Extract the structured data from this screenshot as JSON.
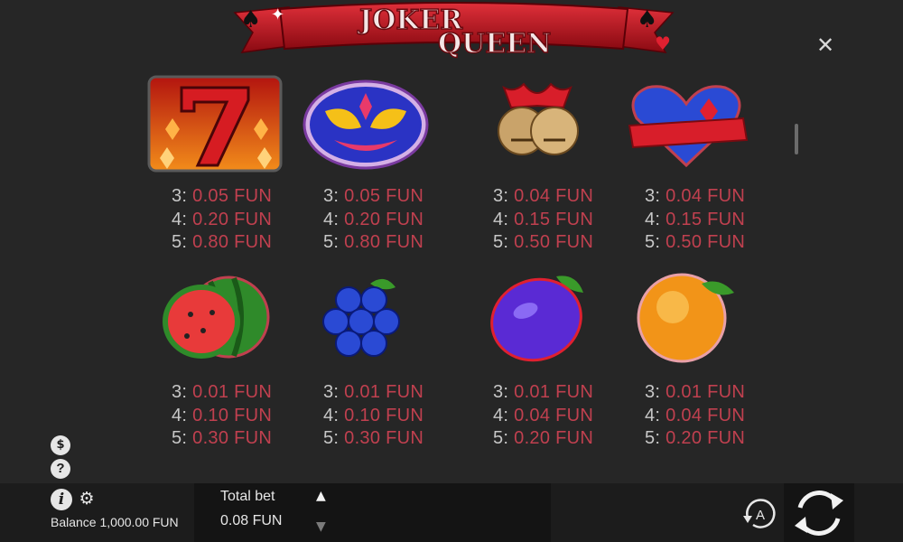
{
  "game": {
    "logo_line1": "JOKER",
    "logo_line2": "QUEEN"
  },
  "close": {
    "label": "✕"
  },
  "paytable": [
    {
      "symbol": "seven-icon",
      "pays": [
        {
          "count": "3:",
          "amount": "0.05 FUN"
        },
        {
          "count": "4:",
          "amount": "0.20 FUN"
        },
        {
          "count": "5:",
          "amount": "0.80 FUN"
        }
      ]
    },
    {
      "symbol": "mask-icon",
      "pays": [
        {
          "count": "3:",
          "amount": "0.05 FUN"
        },
        {
          "count": "4:",
          "amount": "0.20 FUN"
        },
        {
          "count": "5:",
          "amount": "0.80 FUN"
        }
      ]
    },
    {
      "symbol": "bells-icon",
      "pays": [
        {
          "count": "3:",
          "amount": "0.04 FUN"
        },
        {
          "count": "4:",
          "amount": "0.15 FUN"
        },
        {
          "count": "5:",
          "amount": "0.50 FUN"
        }
      ]
    },
    {
      "symbol": "heart-icon",
      "pays": [
        {
          "count": "3:",
          "amount": "0.04 FUN"
        },
        {
          "count": "4:",
          "amount": "0.15 FUN"
        },
        {
          "count": "5:",
          "amount": "0.50 FUN"
        }
      ]
    },
    {
      "symbol": "watermelon-icon",
      "pays": [
        {
          "count": "3:",
          "amount": "0.01 FUN"
        },
        {
          "count": "4:",
          "amount": "0.10 FUN"
        },
        {
          "count": "5:",
          "amount": "0.30 FUN"
        }
      ]
    },
    {
      "symbol": "grapes-icon",
      "pays": [
        {
          "count": "3:",
          "amount": "0.01 FUN"
        },
        {
          "count": "4:",
          "amount": "0.10 FUN"
        },
        {
          "count": "5:",
          "amount": "0.30 FUN"
        }
      ]
    },
    {
      "symbol": "plum-icon",
      "pays": [
        {
          "count": "3:",
          "amount": "0.01 FUN"
        },
        {
          "count": "4:",
          "amount": "0.04 FUN"
        },
        {
          "count": "5:",
          "amount": "0.20 FUN"
        }
      ]
    },
    {
      "symbol": "orange-icon",
      "pays": [
        {
          "count": "3:",
          "amount": "0.01 FUN"
        },
        {
          "count": "4:",
          "amount": "0.04 FUN"
        },
        {
          "count": "5:",
          "amount": "0.20 FUN"
        }
      ]
    }
  ],
  "footer": {
    "balance": "Balance 1,000.00 FUN",
    "total_bet_label": "Total bet",
    "total_bet_value": "0.08 FUN",
    "bet_up_icon": "▲",
    "bet_down_icon": "▼",
    "autoplay_letter": "A",
    "coins_icon": "$",
    "help_icon": "?",
    "info_icon": "i",
    "settings_icon": "⚙"
  },
  "colors": {
    "background": "#262626",
    "payout_amount": "#c0404f",
    "payout_count": "#c7c7c7",
    "banner_red": "#b5121b"
  }
}
